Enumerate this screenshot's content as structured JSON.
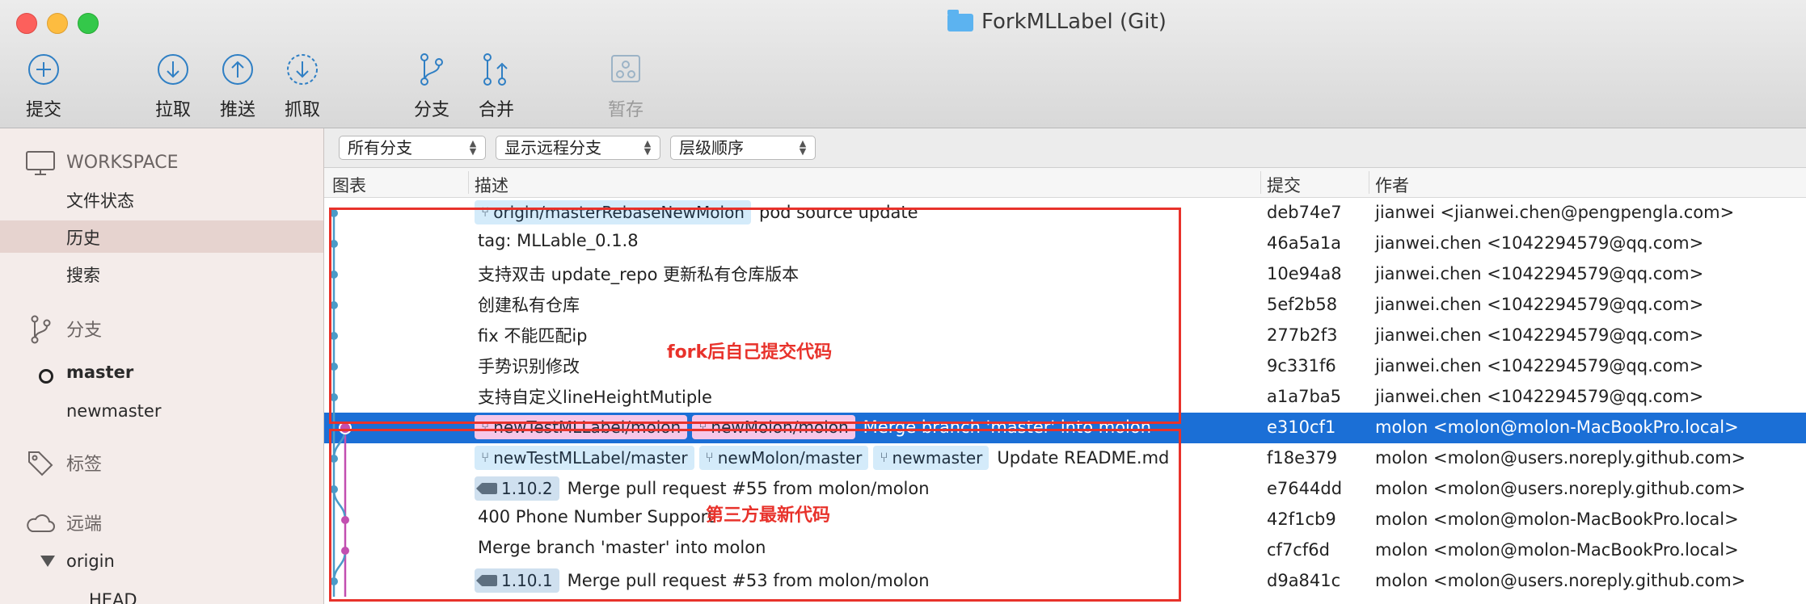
{
  "window": {
    "title": "ForkMLLabel (Git)"
  },
  "toolbar": {
    "commit": "提交",
    "pull": "拉取",
    "push": "推送",
    "fetch": "抓取",
    "branch": "分支",
    "merge": "合并",
    "stash": "暂存"
  },
  "sidebar": {
    "workspace": "WORKSPACE",
    "file_status": "文件状态",
    "history": "历史",
    "search": "搜索",
    "branches_header": "分支",
    "branch_master": "master",
    "branch_newmaster": "newmaster",
    "tags_header": "标签",
    "remotes_header": "远端",
    "remote_origin": "origin",
    "remote_head": "HEAD"
  },
  "filters": {
    "branches": "所有分支",
    "remote": "显示远程分支",
    "order": "层级顺序"
  },
  "columns": {
    "graph": "图表",
    "description": "描述",
    "commit": "提交",
    "author": "作者"
  },
  "commits": [
    {
      "refs": [
        {
          "text": "origin/masterRebaseNewMolon",
          "kind": "branch"
        }
      ],
      "message": "pod source update",
      "hash": "deb74e7",
      "author": "jianwei <jianwei.chen@pengpengla.com>"
    },
    {
      "refs": [],
      "message": "tag: MLLable_0.1.8",
      "hash": "46a5a1a",
      "author": "jianwei.chen <1042294579@qq.com>"
    },
    {
      "refs": [],
      "message": "支持双击 update_repo 更新私有仓库版本",
      "hash": "10e94a8",
      "author": "jianwei.chen <1042294579@qq.com>"
    },
    {
      "refs": [],
      "message": "创建私有仓库",
      "hash": "5ef2b58",
      "author": "jianwei.chen <1042294579@qq.com>"
    },
    {
      "refs": [],
      "message": "fix 不能匹配ip",
      "hash": "277b2f3",
      "author": "jianwei.chen <1042294579@qq.com>"
    },
    {
      "refs": [],
      "message": "手势识别修改",
      "hash": "9c331f6",
      "author": "jianwei.chen <1042294579@qq.com>"
    },
    {
      "refs": [],
      "message": "支持自定义lineHeightMutiple",
      "hash": "a1a7ba5",
      "author": "jianwei.chen <1042294579@qq.com>"
    },
    {
      "refs": [
        {
          "text": "newTestMLLabel/molon",
          "kind": "pink"
        },
        {
          "text": "newMolon/molon",
          "kind": "pink"
        }
      ],
      "message": "Merge branch 'master' into molon",
      "hash": "e310cf1",
      "author": "molon <molon@molon-MacBookPro.local>",
      "selected": true
    },
    {
      "refs": [
        {
          "text": "newTestMLLabel/master",
          "kind": "branch"
        },
        {
          "text": "newMolon/master",
          "kind": "branch"
        },
        {
          "text": "newmaster",
          "kind": "branch"
        }
      ],
      "message": "Update README.md",
      "hash": "f18e379",
      "author": "molon <molon@users.noreply.github.com>"
    },
    {
      "refs": [
        {
          "text": "1.10.2",
          "kind": "tag"
        }
      ],
      "message": "Merge pull request #55 from molon/molon",
      "hash": "e7644dd",
      "author": "molon <molon@users.noreply.github.com>"
    },
    {
      "refs": [],
      "message": "400 Phone Number Support",
      "hash": "42f1cb9",
      "author": "molon <molon@molon-MacBookPro.local>"
    },
    {
      "refs": [],
      "message": "Merge branch 'master' into molon",
      "hash": "cf7cf6d",
      "author": "molon <molon@molon-MacBookPro.local>"
    },
    {
      "refs": [
        {
          "text": "1.10.1",
          "kind": "tag"
        }
      ],
      "message": "Merge pull request #53 from molon/molon",
      "hash": "d9a841c",
      "author": "molon <molon@users.noreply.github.com>"
    }
  ],
  "annotations": {
    "top_label": "fork后自己提交代码",
    "bottom_label": "第三方最新代码"
  },
  "colors": {
    "selection": "#1b6fd6",
    "graph_blue": "#4a9ac8",
    "graph_pink": "#c24fb0",
    "annotation": "#e8322b"
  }
}
